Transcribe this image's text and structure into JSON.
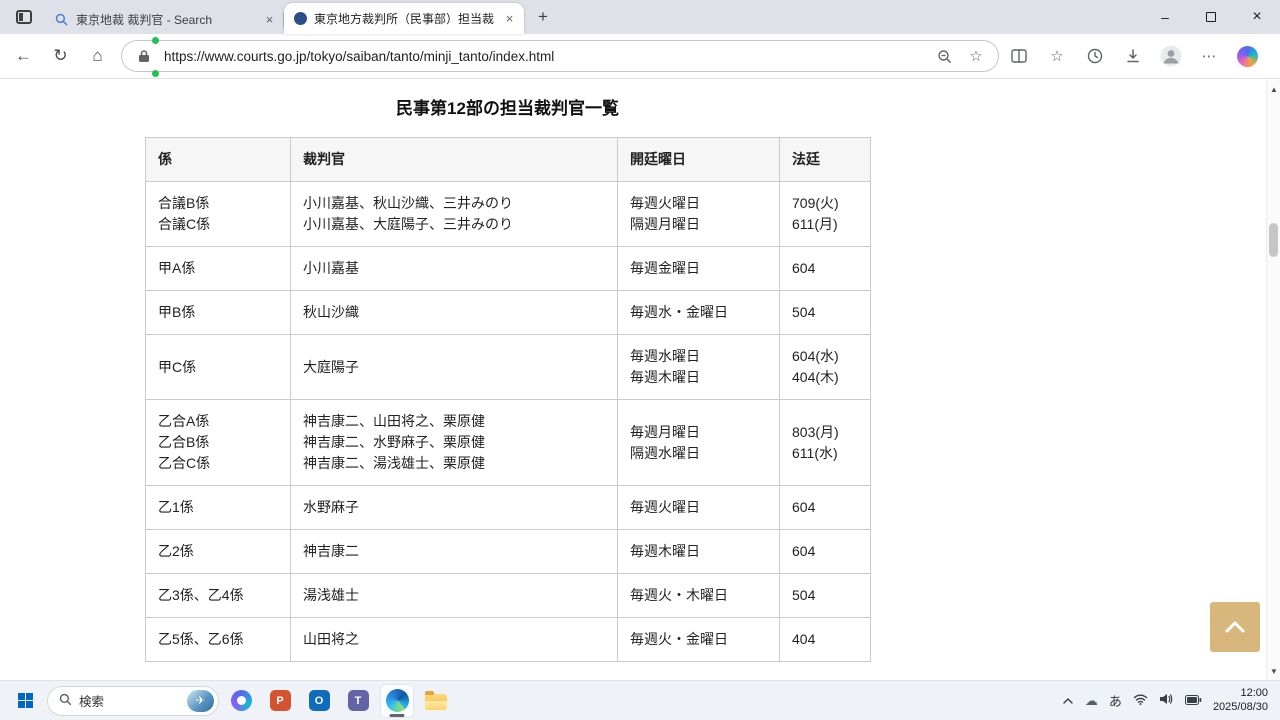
{
  "browser": {
    "tabs": [
      {
        "title": "東京地裁 裁判官 - Search"
      },
      {
        "title": "東京地方裁判所（民事部）担当裁"
      }
    ],
    "url": "https://www.courts.go.jp/tokyo/saiban/tanto/minji_tanto/index.html"
  },
  "page": {
    "title": "民事第12部の担当裁判官一覧",
    "table": {
      "headers": [
        "係",
        "裁判官",
        "開廷曜日",
        "法廷"
      ],
      "rows": [
        [
          "合議B係\n合議C係",
          "小川嘉基、秋山沙織、三井みのり\n小川嘉基、大庭陽子、三井みのり",
          "毎週火曜日\n隔週月曜日",
          "709(火)\n611(月)"
        ],
        [
          "甲A係",
          "小川嘉基",
          "毎週金曜日",
          "604"
        ],
        [
          "甲B係",
          "秋山沙織",
          "毎週水・金曜日",
          "504"
        ],
        [
          "甲C係",
          "大庭陽子",
          "毎週水曜日\n毎週木曜日",
          "604(水)\n404(木)"
        ],
        [
          "乙合A係\n乙合B係\n乙合C係",
          "神吉康二、山田将之、栗原健\n神吉康二、水野麻子、栗原健\n神吉康二、湯浅雄士、栗原健",
          "毎週月曜日\n隔週水曜日",
          "803(月)\n611(水)"
        ],
        [
          "乙1係",
          "水野麻子",
          "毎週火曜日",
          "604"
        ],
        [
          "乙2係",
          "神吉康二",
          "毎週木曜日",
          "604"
        ],
        [
          "乙3係、乙4係",
          "湯浅雄士",
          "毎週火・木曜日",
          "504"
        ],
        [
          "乙5係、乙6係",
          "山田将之",
          "毎週火・金曜日",
          "404"
        ]
      ]
    }
  },
  "taskbar": {
    "search_placeholder": "検索",
    "ime_label": "あ",
    "clock": {
      "time": "12:00",
      "date": "2025/08/30"
    }
  },
  "icons": {
    "close": "×",
    "minimize": "–",
    "new_tab": "+",
    "back": "←",
    "refresh": "↻",
    "home": "⌂",
    "star": "☆",
    "ellipsis": "⋯",
    "cloud": "☁",
    "plane": "✈",
    "scroll_up": "▲",
    "scroll_down": "▼"
  },
  "colors": {
    "back_to_top": "#d8b77c",
    "start_blue": "#0067c0"
  }
}
